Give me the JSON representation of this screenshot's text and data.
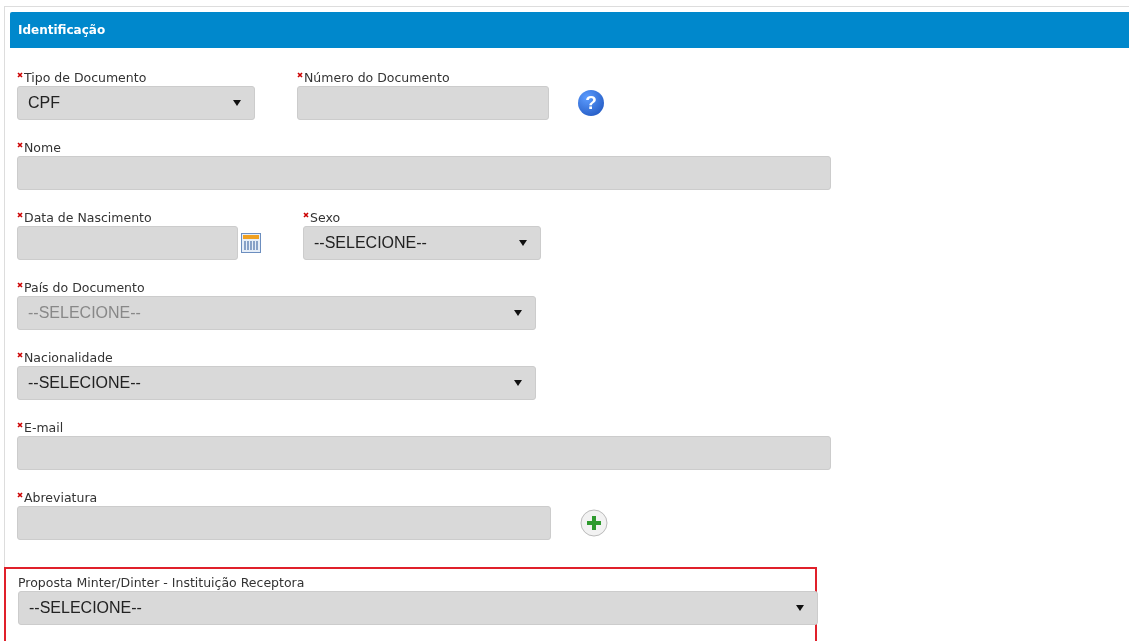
{
  "panel": {
    "title": "Identificação"
  },
  "rows": [
    {
      "fields": [
        {
          "label": "Tipo de Documento",
          "required": true,
          "kind": "select",
          "value": "CPF",
          "disabled": false
        },
        {
          "label": "Número do Documento",
          "required": true,
          "kind": "text",
          "addon": {
            "kind": "help",
            "glyph": "?"
          }
        }
      ]
    },
    {
      "fields": [
        {
          "label": "Nome",
          "required": true,
          "kind": "text"
        }
      ]
    },
    {
      "fields": [
        {
          "label": "Data de Nascimento",
          "required": true,
          "kind": "text",
          "addon": {
            "kind": "calendar"
          }
        },
        {
          "label": "Sexo",
          "required": true,
          "kind": "select",
          "value": "--SELECIONE--",
          "disabled": false
        }
      ]
    },
    {
      "fields": [
        {
          "label": "País do Documento",
          "required": true,
          "kind": "select",
          "value": "--SELECIONE--",
          "disabled": true
        }
      ]
    },
    {
      "fields": [
        {
          "label": "Nacionalidade",
          "required": true,
          "kind": "select",
          "value": "--SELECIONE--",
          "disabled": false
        }
      ]
    },
    {
      "fields": [
        {
          "label": "E-mail",
          "required": true,
          "kind": "text"
        }
      ]
    },
    {
      "fields": [
        {
          "label": "Abreviatura",
          "required": true,
          "kind": "text",
          "addon": {
            "kind": "add"
          }
        }
      ]
    }
  ],
  "highlighted_section": {
    "highlighted": true,
    "label": "Proposta Minter/Dinter - Instituição Receptora",
    "kind": "select",
    "value": "--SELECIONE--",
    "disabled": false
  }
}
